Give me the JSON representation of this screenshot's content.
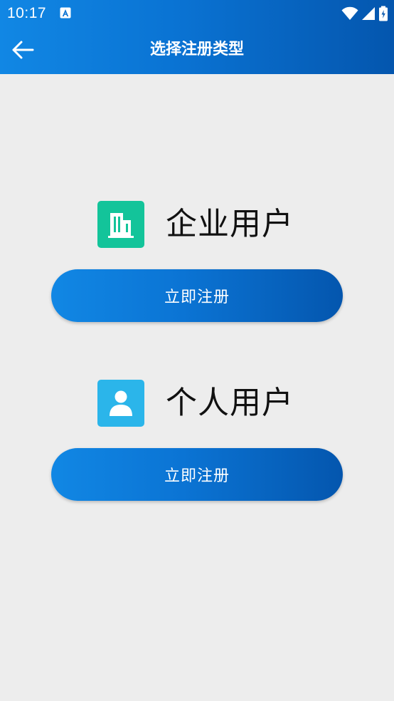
{
  "status_bar": {
    "time": "10:17"
  },
  "header": {
    "title": "选择注册类型",
    "back_icon": "arrow-left-icon"
  },
  "options": [
    {
      "label": "企业用户",
      "icon": "building-icon",
      "icon_color": "#13c49a",
      "button_label": "立即注册"
    },
    {
      "label": "个人用户",
      "icon": "person-icon",
      "icon_color": "#2bb5ea",
      "button_label": "立即注册"
    }
  ],
  "colors": {
    "accent_start": "#1187e4",
    "accent_end": "#0456ae",
    "background": "#ededed"
  }
}
